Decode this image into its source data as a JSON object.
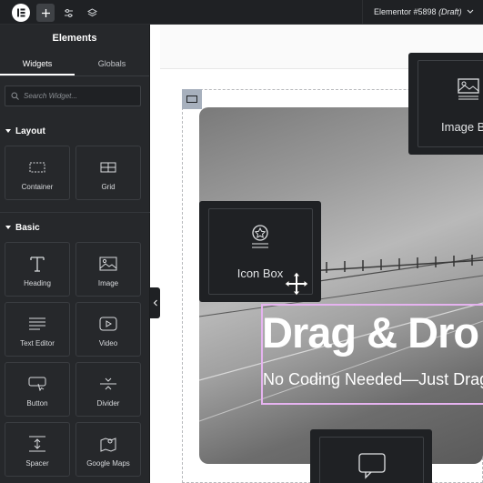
{
  "topbar": {
    "logo_icon": "elementor-logo-icon",
    "add_icon": "plus-icon",
    "settings_icon": "sliders-icon",
    "structure_icon": "layers-icon",
    "document_title": "Elementor #5898",
    "document_status": "(Draft)"
  },
  "sidebar": {
    "title": "Elements",
    "tabs": [
      {
        "label": "Widgets"
      },
      {
        "label": "Globals"
      }
    ],
    "search": {
      "placeholder": "Search Widget..."
    },
    "sections": [
      {
        "label": "Layout",
        "widgets": [
          {
            "label": "Container",
            "icon": "container-icon"
          },
          {
            "label": "Grid",
            "icon": "grid-icon"
          }
        ]
      },
      {
        "label": "Basic",
        "widgets": [
          {
            "label": "Heading",
            "icon": "heading-icon"
          },
          {
            "label": "Image",
            "icon": "image-icon"
          },
          {
            "label": "Text Editor",
            "icon": "text-editor-icon"
          },
          {
            "label": "Video",
            "icon": "video-icon"
          },
          {
            "label": "Button",
            "icon": "button-icon"
          },
          {
            "label": "Divider",
            "icon": "divider-icon"
          },
          {
            "label": "Spacer",
            "icon": "spacer-icon"
          },
          {
            "label": "Google Maps",
            "icon": "map-icon"
          }
        ]
      }
    ]
  },
  "canvas": {
    "hero_title": "Drag & Dro",
    "hero_subtitle": "No Coding Needed—Just Drag",
    "floating_widgets": [
      {
        "label": "Icon Box",
        "icon": "icon-box-icon"
      },
      {
        "label": "Image B",
        "icon": "image-box-icon"
      },
      {
        "label": "",
        "icon": "speech-bubble-icon"
      }
    ]
  },
  "colors": {
    "panel_bg": "#26282b",
    "topbar_bg": "#1f2124",
    "selection_border": "#e6b3f0"
  }
}
